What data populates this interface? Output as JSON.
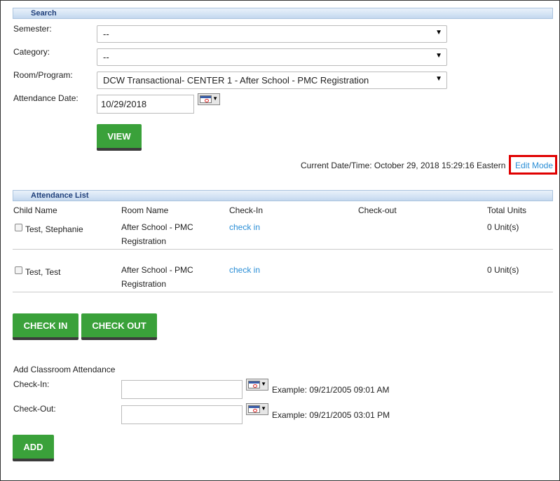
{
  "search": {
    "header": "Search",
    "semester_label": "Semester:",
    "semester_value": "--",
    "category_label": "Category:",
    "category_value": "--",
    "room_label": "Room/Program:",
    "room_value": "DCW Transactional- CENTER 1 - After School - PMC Registration",
    "date_label": "Attendance Date:",
    "date_value": "10/29/2018",
    "view_button": "VIEW",
    "current_datetime": "Current Date/Time: October 29, 2018 15:29:16  Eastern",
    "edit_mode": "Edit Mode"
  },
  "attendance": {
    "header": "Attendance List",
    "columns": [
      "Child Name",
      "Room Name",
      "Check-In",
      "Check-out",
      "Total Units"
    ],
    "rows": [
      {
        "name": "Test, Stephanie",
        "room_line1": "After School - PMC",
        "room_line2": "Registration",
        "checkin": "check in",
        "checkout": "",
        "units": "0 Unit(s)"
      },
      {
        "name": "Test, Test",
        "room_line1": "After School - PMC",
        "room_line2": "Registration",
        "checkin": "check in",
        "checkout": "",
        "units": "0 Unit(s)"
      }
    ],
    "checkin_button": "CHECK IN",
    "checkout_button": "CHECK OUT"
  },
  "classroom": {
    "title": "Add Classroom Attendance",
    "checkin_label": "Check-In:",
    "checkin_value": "",
    "checkin_example": "Example: 09/21/2005 09:01 AM",
    "checkout_label": "Check-Out:",
    "checkout_value": "",
    "checkout_example": "Example: 09/21/2005 03:01 PM",
    "add_button": "ADD"
  },
  "colors": {
    "button_green": "#3aa13a",
    "link_blue": "#2a8ed6",
    "header_text": "#1f3f7a",
    "highlight_red": "#e00000"
  }
}
